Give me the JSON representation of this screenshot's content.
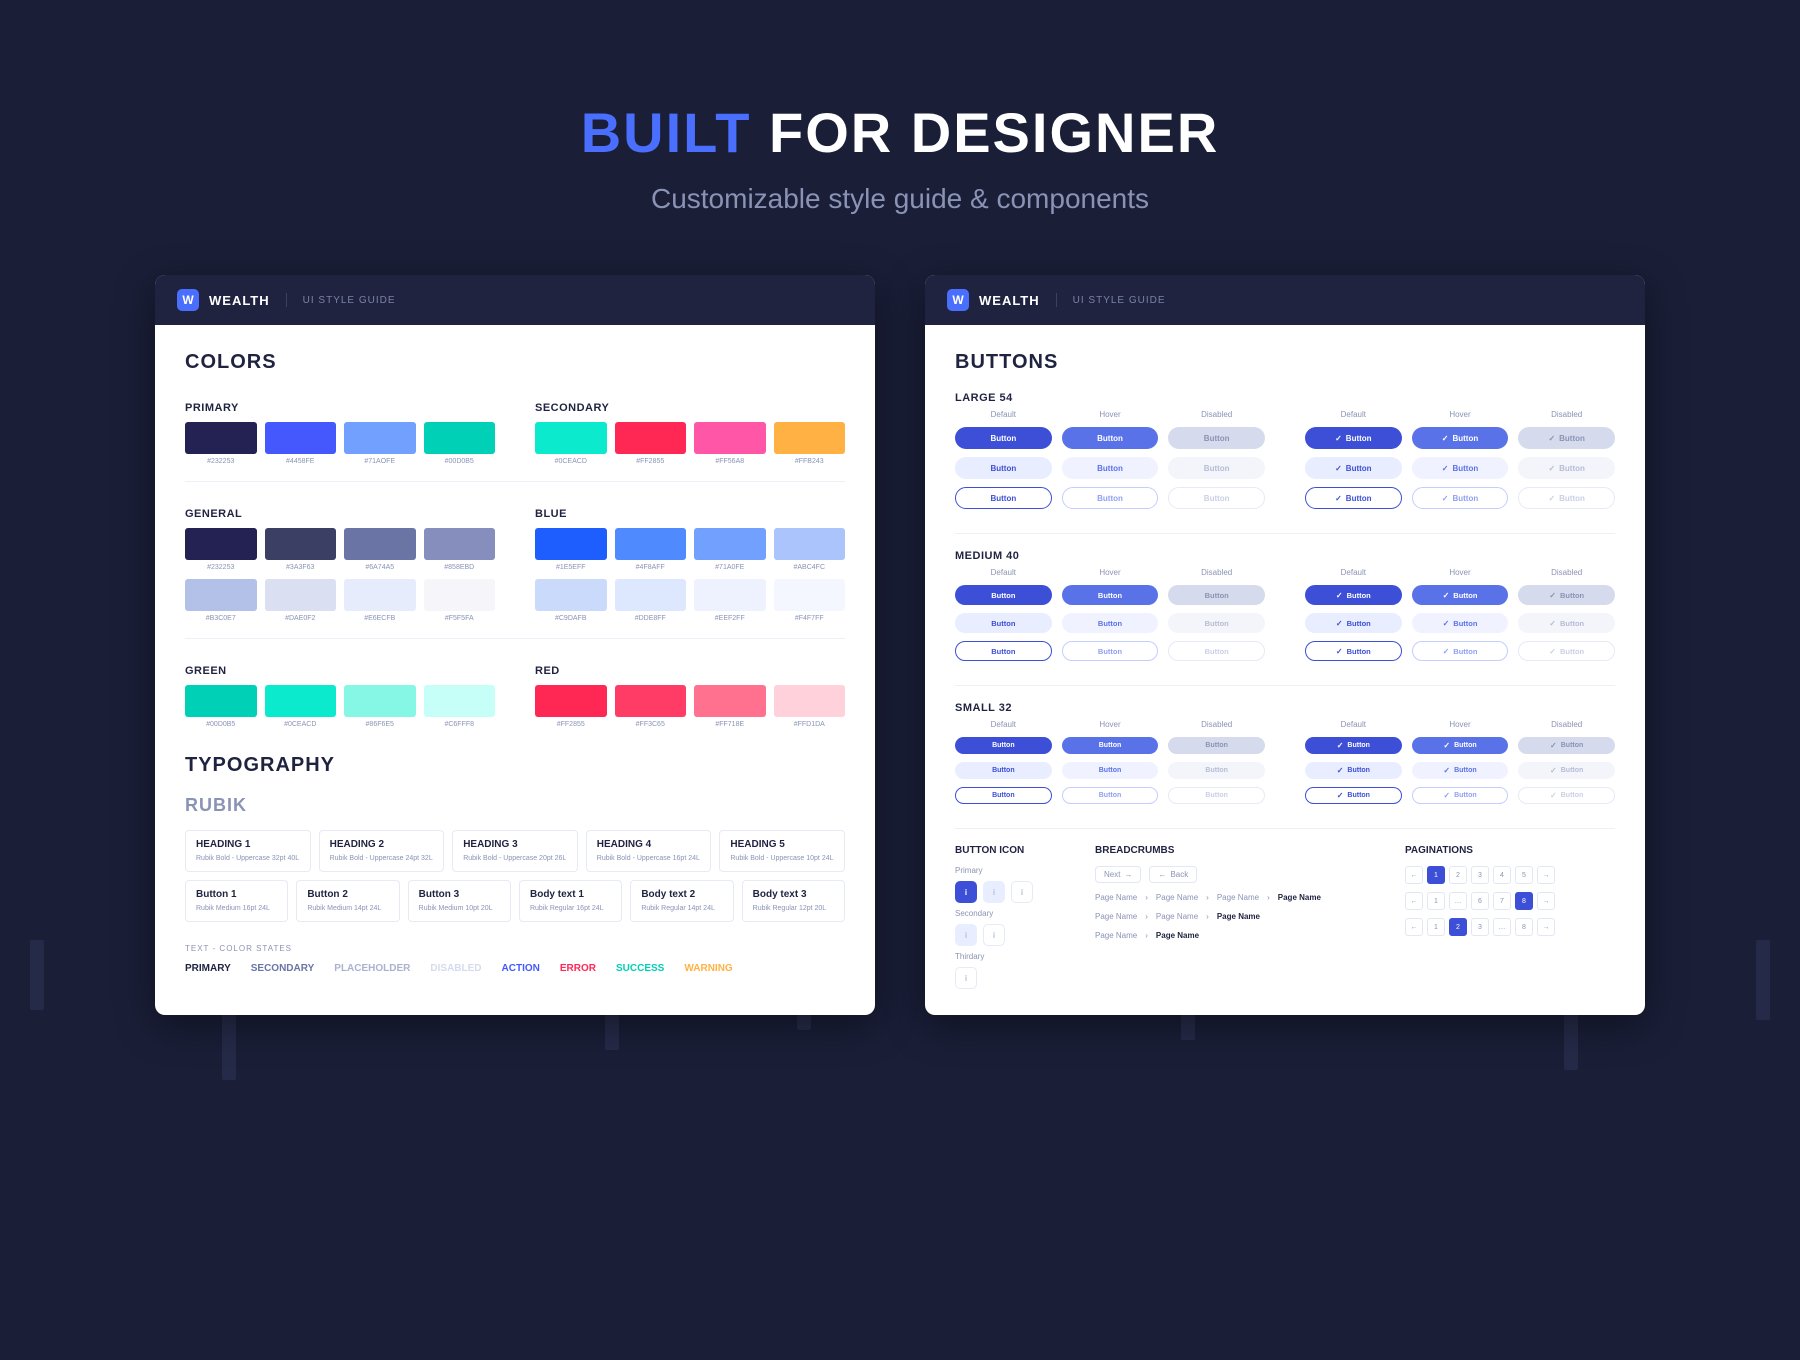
{
  "hero": {
    "title_accent": "BUILT",
    "title_rest": " FOR DESIGNER",
    "subtitle": "Customizable style guide & components"
  },
  "brand": {
    "name": "WEALTH",
    "sub": "UI STYLE GUIDE"
  },
  "left": {
    "colors_title": "COLORS",
    "typo_title": "TYPOGRAPHY",
    "font_name": "RUBIK",
    "primary_label": "PRIMARY",
    "secondary_label": "SECONDARY",
    "general_label": "GENERAL",
    "blue_label": "BLUE",
    "green_label": "GREEN",
    "red_label": "RED",
    "primary": [
      "#232253",
      "#4458FE",
      "#71AOFE",
      "#00D0B5"
    ],
    "secondary": [
      "#0CEACD",
      "#FF2855",
      "#FF56A8",
      "#FFB243"
    ],
    "general1": [
      "#232253",
      "#3A3F63",
      "#6A74A5",
      "#858EBD"
    ],
    "general2": [
      "#B3C0E7",
      "#DAE0F2",
      "#E6ECFB",
      "#F5F5FA"
    ],
    "blue1": [
      "#1E5EFF",
      "#4F8AFF",
      "#71A0FE",
      "#ABC4FC"
    ],
    "blue2": [
      "#C9DAFB",
      "#DDE8FF",
      "#EEF2FF",
      "#F4F7FF"
    ],
    "green": [
      "#00D0B5",
      "#0CEACD",
      "#86F6E5",
      "#C6FFF8"
    ],
    "red": [
      "#FF2855",
      "#FF3C65",
      "#FF718E",
      "#FFD1DA"
    ],
    "headings": [
      {
        "name": "HEADING 1",
        "desc": "Rubik Bold - Uppercase 32pt 40L"
      },
      {
        "name": "HEADING 2",
        "desc": "Rubik Bold - Uppercase 24pt 32L"
      },
      {
        "name": "HEADING 3",
        "desc": "Rubik Bold - Uppercase 20pt 26L"
      },
      {
        "name": "HEADING 4",
        "desc": "Rubik Bold - Uppercase 16pt 24L"
      },
      {
        "name": "HEADING 5",
        "desc": "Rubik Bold - Uppercase 10pt 24L"
      }
    ],
    "body": [
      {
        "name": "Button 1",
        "desc": "Rubik Medium 16pt 24L"
      },
      {
        "name": "Button 2",
        "desc": "Rubik Medium 14pt 24L"
      },
      {
        "name": "Button 3",
        "desc": "Rubik Medium 10pt 20L"
      },
      {
        "name": "Body text 1",
        "desc": "Rubik Regular 16pt 24L"
      },
      {
        "name": "Body text 2",
        "desc": "Rubik Regular 14pt 24L"
      },
      {
        "name": "Body text 3",
        "desc": "Rubik Regular 12pt 20L"
      }
    ],
    "states_label": "TEXT - COLOR STATES",
    "states": [
      {
        "t": "PRIMARY",
        "c": "#1f2340"
      },
      {
        "t": "SECONDARY",
        "c": "#6A74A5"
      },
      {
        "t": "PLACEHOLDER",
        "c": "#aab2cf"
      },
      {
        "t": "DISABLED",
        "c": "#d5dbec"
      },
      {
        "t": "ACTION",
        "c": "#4458FE"
      },
      {
        "t": "ERROR",
        "c": "#FF2855"
      },
      {
        "t": "SUCCESS",
        "c": "#00D0B5"
      },
      {
        "t": "WARNING",
        "c": "#FFB243"
      }
    ]
  },
  "right": {
    "buttons_title": "BUTTONS",
    "large_label": "LARGE 54",
    "medium_label": "MEDIUM 40",
    "small_label": "SMALL 32",
    "cols": [
      "Default",
      "Hover",
      "Disabled"
    ],
    "btn_text": "Button",
    "icon_label": "BUTTON ICON",
    "breadcrumbs_label": "BREADCRUMBS",
    "pag_label": "PAGINATIONS",
    "primary_label": "Primary",
    "secondary_label": "Secondary",
    "thirdary_label": "Thirdary",
    "next": "Next",
    "back": "Back",
    "page": "Page Name"
  }
}
